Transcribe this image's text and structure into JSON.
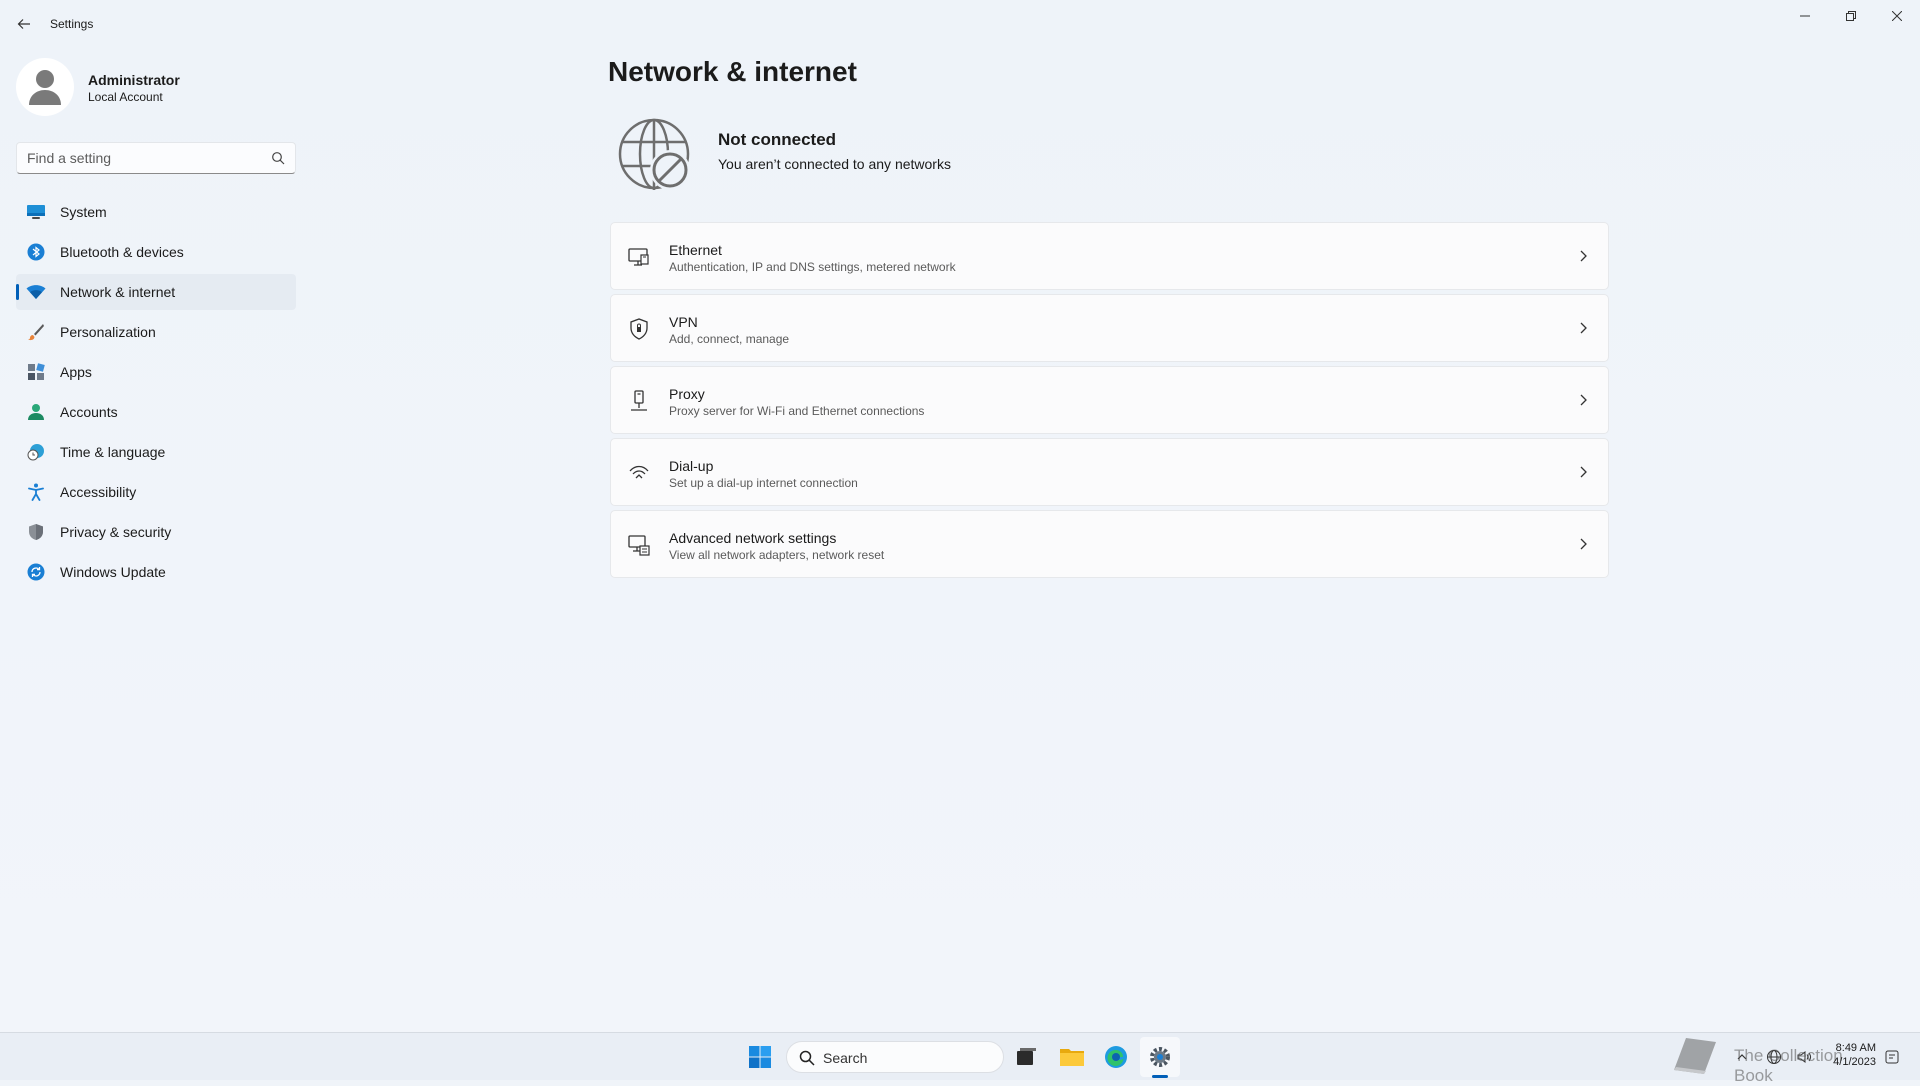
{
  "window": {
    "app_title": "Settings"
  },
  "profile": {
    "name": "Administrator",
    "account_type": "Local Account"
  },
  "search": {
    "placeholder": "Find a setting"
  },
  "sidebar": {
    "items": [
      {
        "label": "System",
        "icon": "monitor-icon"
      },
      {
        "label": "Bluetooth & devices",
        "icon": "bluetooth-icon"
      },
      {
        "label": "Network & internet",
        "icon": "wifi-icon",
        "active": true
      },
      {
        "label": "Personalization",
        "icon": "brush-icon"
      },
      {
        "label": "Apps",
        "icon": "apps-icon"
      },
      {
        "label": "Accounts",
        "icon": "person-icon"
      },
      {
        "label": "Time & language",
        "icon": "clock-globe-icon"
      },
      {
        "label": "Accessibility",
        "icon": "accessibility-icon"
      },
      {
        "label": "Privacy & security",
        "icon": "shield-icon"
      },
      {
        "label": "Windows Update",
        "icon": "update-icon"
      }
    ]
  },
  "main": {
    "title": "Network & internet",
    "status": {
      "title": "Not connected",
      "subtitle": "You aren’t connected to any networks"
    },
    "cards": [
      {
        "title": "Ethernet",
        "subtitle": "Authentication, IP and DNS settings, metered network",
        "icon": "ethernet-icon"
      },
      {
        "title": "VPN",
        "subtitle": "Add, connect, manage",
        "icon": "vpn-shield-icon"
      },
      {
        "title": "Proxy",
        "subtitle": "Proxy server for Wi-Fi and Ethernet connections",
        "icon": "proxy-icon"
      },
      {
        "title": "Dial-up",
        "subtitle": "Set up a dial-up internet connection",
        "icon": "dialup-icon"
      },
      {
        "title": "Advanced network settings",
        "subtitle": "View all network adapters, network reset",
        "icon": "advanced-network-icon"
      }
    ]
  },
  "taskbar": {
    "search_label": "Search",
    "watermark_text": "The Collection Book",
    "clock_time": "8:49 AM",
    "clock_date": "4/1/2023"
  },
  "colors": {
    "accent": "#005fb8",
    "background": "#eef3f9"
  }
}
